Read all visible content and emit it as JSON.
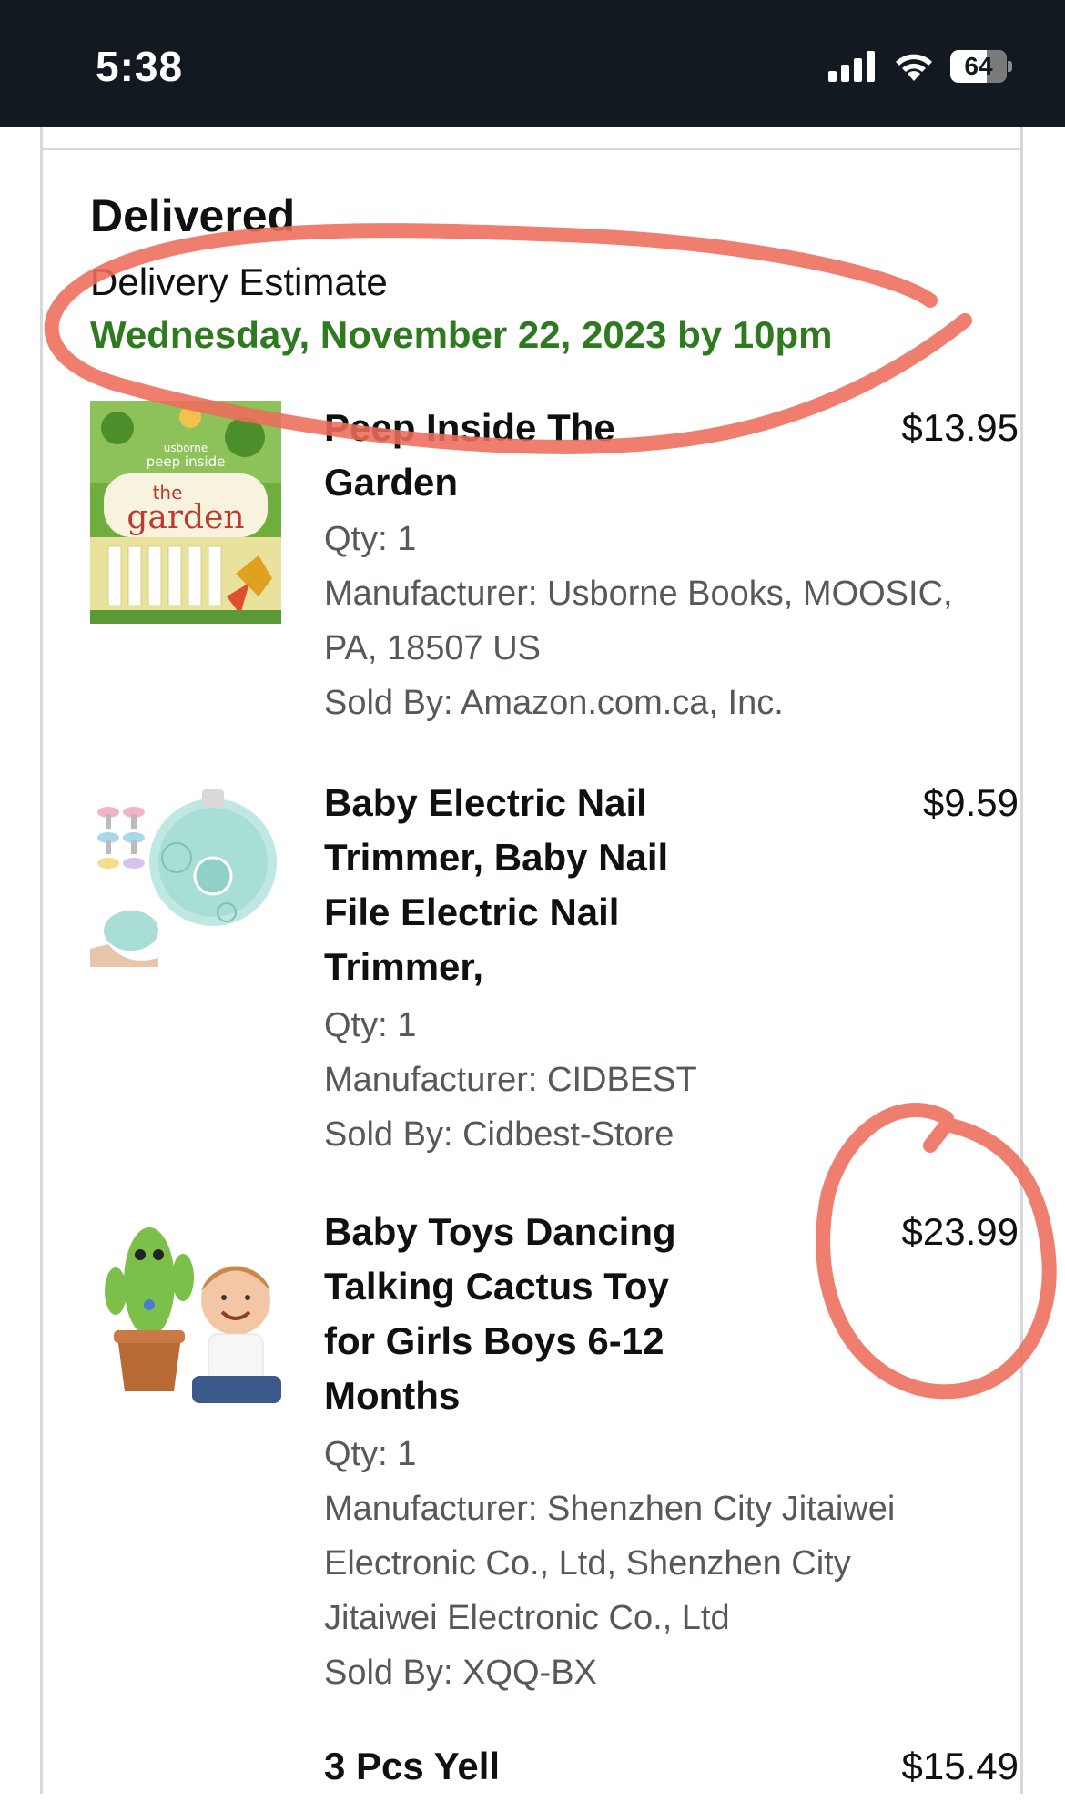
{
  "status_bar": {
    "time": "5:38",
    "battery_level": "64",
    "battery_fraction": 0.64,
    "icons": [
      "cellular-signal-icon",
      "wifi-icon",
      "battery-icon"
    ]
  },
  "shipment": {
    "status": "Delivered",
    "estimate_label": "Delivery Estimate",
    "estimate_date": "Wednesday, November 22, 2023 by 10pm",
    "date_color": "#2d7a1f"
  },
  "items": [
    {
      "title_lines": [
        "Peep Inside The",
        "Garden"
      ],
      "price": "$13.95",
      "qty": "Qty: 1",
      "manufacturer_lines": [
        "Manufacturer: Usborne Books, MOOSIC,",
        "PA, 18507 US"
      ],
      "sold_by": "Sold By: Amazon.com.ca, Inc.",
      "thumb_text": {
        "publisher": "usborne",
        "series": "peep inside",
        "article": "the",
        "name": "garden"
      }
    },
    {
      "title_lines": [
        "Baby Electric Nail",
        "Trimmer, Baby Nail",
        "File Electric Nail",
        "Trimmer,"
      ],
      "price": "$9.59",
      "qty": "Qty: 1",
      "manufacturer_lines": [
        "Manufacturer: CIDBEST"
      ],
      "sold_by": "Sold By: Cidbest-Store"
    },
    {
      "title_lines": [
        "Baby Toys Dancing",
        "Talking Cactus Toy",
        "for Girls Boys 6-12",
        "Months"
      ],
      "price": "$23.99",
      "qty": "Qty: 1",
      "manufacturer_lines": [
        "Manufacturer: Shenzhen City Jitaiwei",
        "Electronic Co., Ltd, Shenzhen City",
        "Jitaiwei Electronic Co., Ltd"
      ],
      "sold_by": "Sold By: XQQ-BX"
    },
    {
      "title_lines": [
        "3 Pcs Yell"
      ],
      "price": "$15.49"
    }
  ],
  "annotation_color": "#ee6c5b"
}
